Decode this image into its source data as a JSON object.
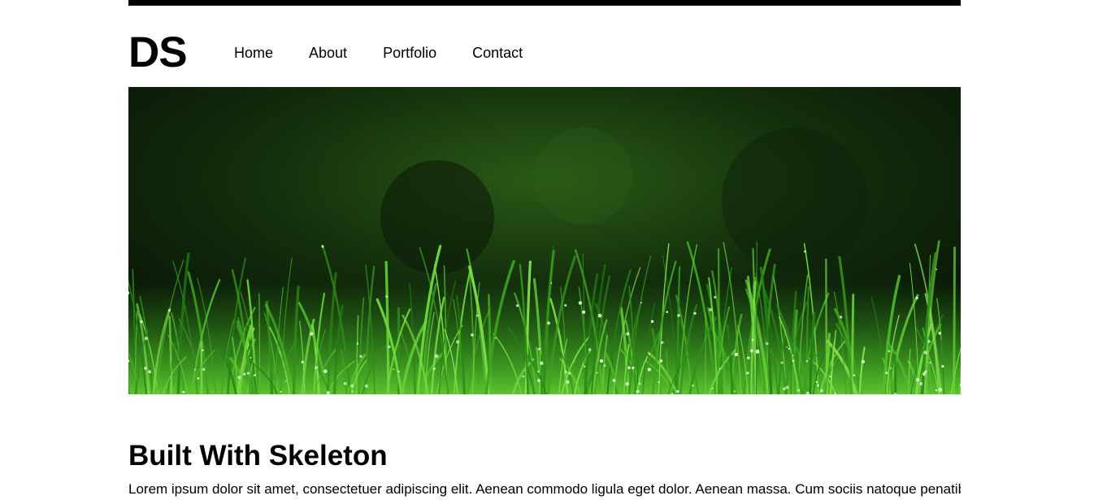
{
  "header": {
    "logo": "DS",
    "nav": [
      {
        "label": "Home"
      },
      {
        "label": "About"
      },
      {
        "label": "Portfolio"
      },
      {
        "label": "Contact"
      }
    ]
  },
  "hero": {
    "image_icon": "grass-photo"
  },
  "content": {
    "heading": "Built With Skeleton",
    "paragraph": "Lorem ipsum dolor sit amet, consectetuer adipiscing elit. Aenean commodo ligula eget dolor. Aenean massa. Cum sociis natoque penatibus et"
  }
}
